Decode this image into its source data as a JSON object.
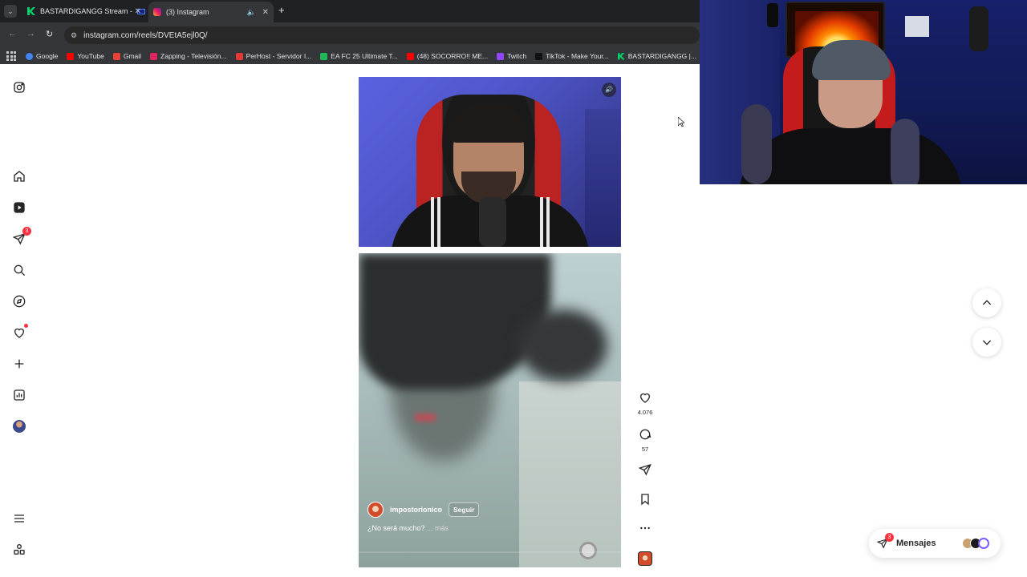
{
  "browser": {
    "tabs": [
      {
        "title": "BASTARDIGANGG Stream -",
        "active": false
      },
      {
        "title": "(3) Instagram",
        "active": true
      }
    ],
    "url": "instagram.com/reels/DVEtA5ejl0Q/",
    "bookmarks": [
      {
        "label": "Google",
        "color": "#4285f4"
      },
      {
        "label": "YouTube",
        "color": "#ff0000"
      },
      {
        "label": "Gmail",
        "color": "#ea4335"
      },
      {
        "label": "Zapping - Televisión...",
        "color": "#e0245e"
      },
      {
        "label": "PerHost - Servidor I...",
        "color": "#e53935"
      },
      {
        "label": "EA FC 25 Ultimate T...",
        "color": "#1db954"
      },
      {
        "label": "(48) SOCORRO!! ME...",
        "color": "#ff0000"
      },
      {
        "label": "Twitch",
        "color": "#9146ff"
      },
      {
        "label": "TikTok - Make Your...",
        "color": "#111111"
      },
      {
        "label": "BASTARDIGANGG |...",
        "color": "#00d26a"
      }
    ]
  },
  "sidebar": {
    "notifications_badge": "3"
  },
  "reel": {
    "username": "impostorionico",
    "follow_label": "Seguir",
    "caption": "¿No será mucho?",
    "more_label": "... más",
    "likes": "4.076",
    "comments": "57"
  },
  "messages": {
    "label": "Mensajes",
    "badge": "3"
  },
  "colors": {
    "instagram_text": "#262626",
    "badge_red": "#ff3040",
    "browser_dark": "#202124"
  }
}
